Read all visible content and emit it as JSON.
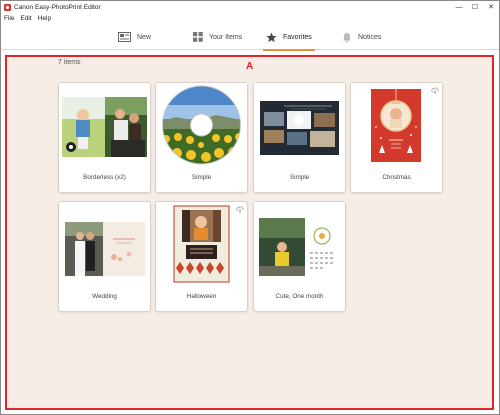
{
  "window": {
    "title": "Canon Easy-PhotoPrint Editor",
    "controls": [
      "—",
      "☐",
      "✕"
    ]
  },
  "menu": {
    "items": [
      "File",
      "Edit",
      "Help"
    ]
  },
  "nav": {
    "tabs": [
      {
        "label": "New",
        "icon": "new-icon",
        "active": false
      },
      {
        "label": "Your Items",
        "icon": "grid-icon",
        "active": false
      },
      {
        "label": "Favorites",
        "icon": "star-icon",
        "active": true
      },
      {
        "label": "Notices",
        "icon": "bell-icon",
        "active": false
      }
    ],
    "accent_color": "#e39237"
  },
  "content": {
    "count_text": "7 items",
    "marker": "A",
    "highlight_color": "#e3242b",
    "background": "#f6ede6",
    "items": [
      {
        "label": "Borderless (x2)",
        "thumbnail": "photo-pair",
        "download_icon": false
      },
      {
        "label": "Simple",
        "thumbnail": "disc-sunflowers",
        "download_icon": false
      },
      {
        "label": "Simple",
        "thumbnail": "collage-dark",
        "download_icon": false
      },
      {
        "label": "Christmas",
        "thumbnail": "christmas-card",
        "download_icon": true
      },
      {
        "label": "Wedding",
        "thumbnail": "wedding-card",
        "download_icon": true
      },
      {
        "label": "Halloween",
        "thumbnail": "halloween-card",
        "download_icon": true
      },
      {
        "label": "Cute, One month",
        "thumbnail": "calendar-page",
        "download_icon": false
      }
    ]
  }
}
